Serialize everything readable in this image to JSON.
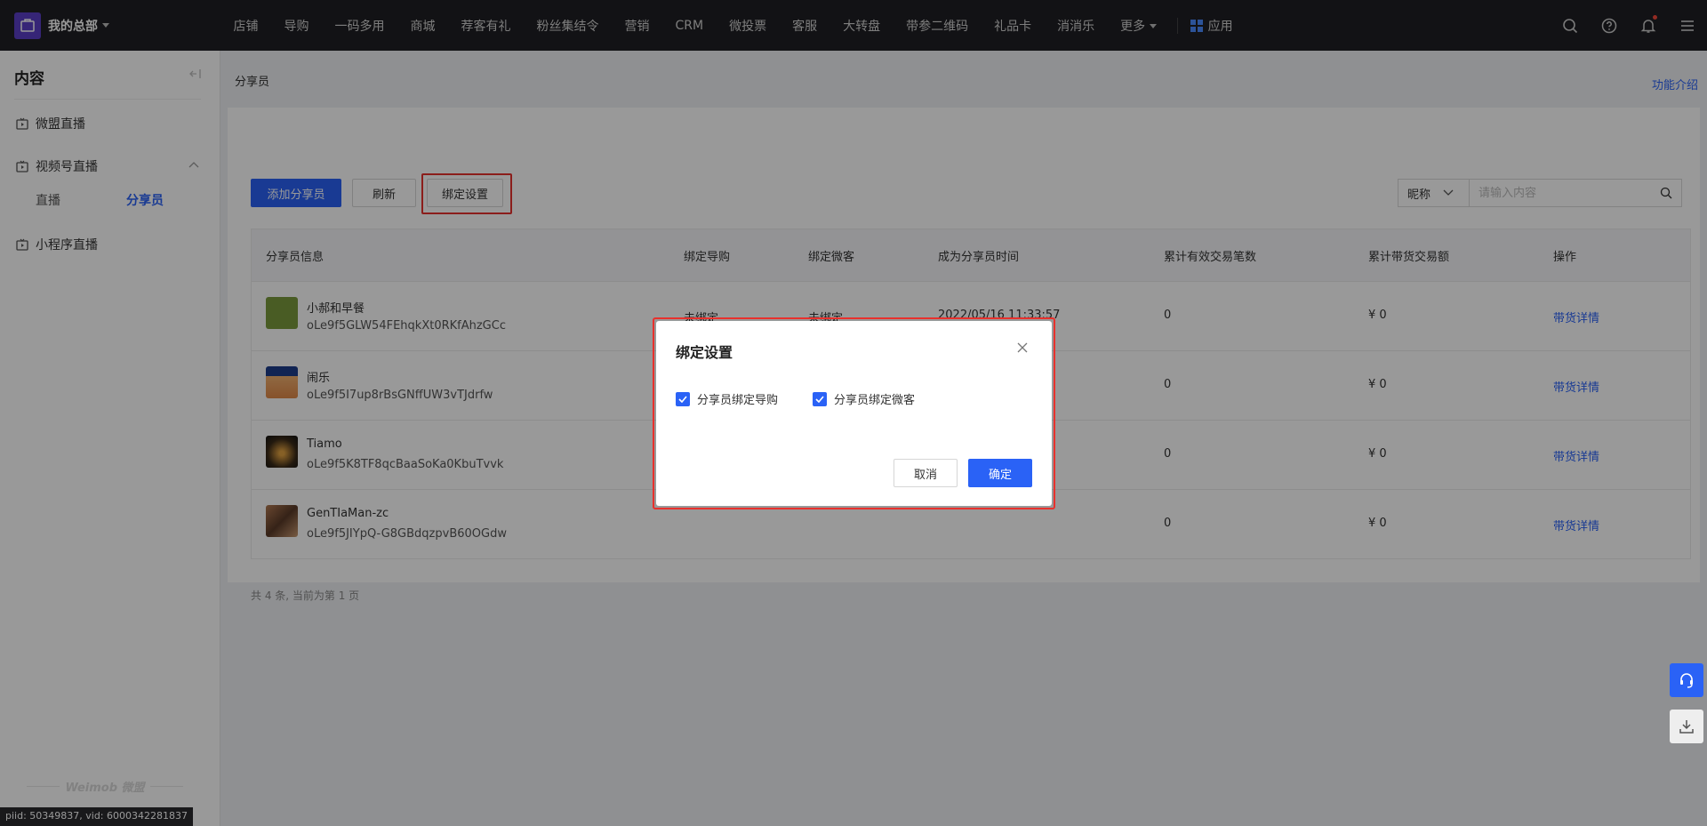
{
  "topbar": {
    "org_name": "我的总部",
    "nav": [
      "店铺",
      "导购",
      "一码多用",
      "商城",
      "荐客有礼",
      "粉丝集结令",
      "营销",
      "CRM",
      "微投票",
      "客服",
      "大转盘",
      "带参二维码",
      "礼品卡",
      "消消乐"
    ],
    "more": "更多",
    "apps": "应用"
  },
  "sidebar": {
    "title": "内容",
    "items": [
      "微盟直播",
      "视频号直播",
      "小程序直播"
    ],
    "sub_items": [
      "直播",
      "分享员"
    ],
    "watermark": "Weimob 微盟"
  },
  "debug": "piid: 50349837, vid: 6000342281837",
  "main": {
    "breadcrumb": "分享员",
    "func_intro": "功能介绍",
    "buttons": {
      "add": "添加分享员",
      "refresh": "刷新",
      "bind": "绑定设置"
    },
    "search": {
      "select": "昵称",
      "placeholder": "请输入内容"
    },
    "columns": [
      "分享员信息",
      "绑定导购",
      "绑定微客",
      "成为分享员时间",
      "累计有效交易笔数",
      "累计带货交易额",
      "操作"
    ],
    "rows": [
      {
        "name": "小郝和早餐",
        "id": "oLe9f5GLW54FEhqkXt0RKfAhzGCc",
        "guide": "未绑定",
        "weike": "未绑定",
        "time": "2022/05/16 11:33:57",
        "count": "0",
        "amount": "¥ 0",
        "action": "带货详情"
      },
      {
        "name": "闹乐",
        "id": "oLe9f5I7up8rBsGNffUW3vTJdrfw",
        "guide": "",
        "weike": "",
        "time": "",
        "count": "0",
        "amount": "¥ 0",
        "action": "带货详情"
      },
      {
        "name": "Tiamo",
        "id": "oLe9f5K8TF8qcBaaSoKa0KbuTvvk",
        "guide": "",
        "weike": "",
        "time": "",
        "count": "0",
        "amount": "¥ 0",
        "action": "带货详情"
      },
      {
        "name": "GenTIaMan-zc",
        "id": "oLe9f5JIYpQ-G8GBdqzpvB60OGdw",
        "guide": "",
        "weike": "",
        "time": "",
        "count": "0",
        "amount": "¥ 0",
        "action": "带货详情"
      }
    ],
    "pager": "共 4 条, 当前为第 1 页"
  },
  "modal": {
    "title": "绑定设置",
    "options": [
      "分享员绑定导购",
      "分享员绑定微客"
    ],
    "cancel": "取消",
    "confirm": "确定"
  },
  "colors": {
    "accent": "#2a62f6",
    "highlight": "#e8312d",
    "topbar": "#1f1f23"
  }
}
